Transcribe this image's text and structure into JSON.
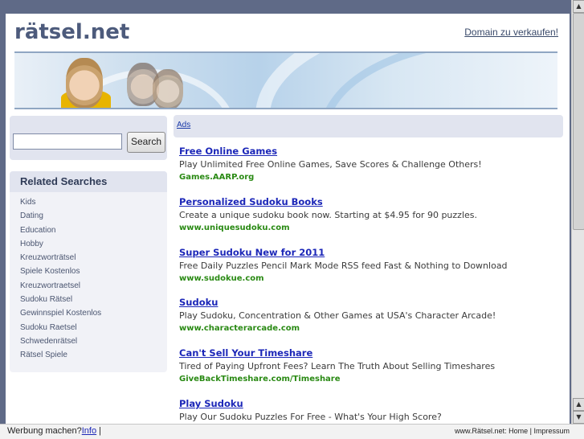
{
  "header": {
    "site_title": "rätsel.net",
    "domain_link": "Domain zu verkaufen!"
  },
  "search": {
    "button_label": "Search",
    "input_value": ""
  },
  "related": {
    "heading": "Related Searches",
    "items": [
      "Kids",
      "Dating",
      "Education",
      "Hobby",
      "Kreuzworträtsel",
      "Spiele Kostenlos",
      "Kreuzwortraetsel",
      "Sudoku Rätsel",
      "Gewinnspiel Kostenlos",
      "Sudoku Raetsel",
      "Schwedenrätsel",
      "Rätsel Spiele"
    ]
  },
  "ads": {
    "label": "Ads",
    "items": [
      {
        "title": "Free Online Games",
        "desc": "Play Unlimited Free Online Games, Save Scores & Challenge Others!",
        "url": "Games.AARP.org"
      },
      {
        "title": "Personalized Sudoku Books",
        "desc": "Create a unique sudoku book now. Starting at $4.95 for 90 puzzles.",
        "url": "www.uniquesudoku.com"
      },
      {
        "title": "Super Sudoku New for 2011",
        "desc": "Free Daily Puzzles Pencil Mark Mode RSS feed Fast & Nothing to Download",
        "url": "www.sudokue.com"
      },
      {
        "title": "Sudoku",
        "desc": "Play Sudoku, Concentration & Other Games at USA's Character Arcade!",
        "url": "www.characterarcade.com"
      },
      {
        "title": "Can't Sell Your Timeshare",
        "desc": "Tired of Paying Upfront Fees? Learn The Truth About Selling Timeshares",
        "url": "GiveBackTimeshare.com/Timeshare"
      },
      {
        "title": "Play Sudoku",
        "desc": "Play Our Sudoku Puzzles For Free - What's Your High Score?",
        "url": ""
      }
    ]
  },
  "footer": {
    "werbung": "Werbung machen?",
    "info": "Info",
    "sep": "|",
    "site": "www.Rätsel.net:",
    "home": "Home",
    "pipe": "|",
    "impressum": "Impressum"
  },
  "icons": {
    "scroll_up": "triangle-up",
    "scroll_down": "triangle-down"
  }
}
